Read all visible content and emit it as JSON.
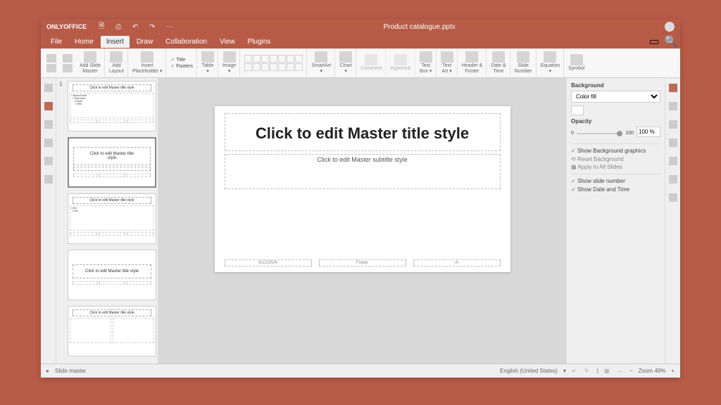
{
  "app": {
    "brand": "ONLYOFFICE",
    "filename": "Product catalogue.pptx"
  },
  "menu": {
    "items": [
      "File",
      "Home",
      "Insert",
      "Draw",
      "Collaboration",
      "View",
      "Plugins"
    ],
    "active_index": 2
  },
  "ribbon": {
    "add_slide_master": "Add Slide\nMaster",
    "add_layout": "Add\nLayout",
    "insert_placeholder": "Insert\nPlaceholder ▾",
    "chk_title": "Title",
    "chk_footers": "Footers",
    "table": "Table\n▾",
    "image": "Image\n▾",
    "smartart": "SmartArt\n▾",
    "chart": "Chart\n▾",
    "comment": "Comment",
    "hyperlink": "Hyperlink",
    "textbox": "Text\nBox ▾",
    "textart": "Text\nArt ▾",
    "header_footer": "Header &\nFooter",
    "date_time": "Date &\nTime",
    "slide_number": "Slide\nNumber",
    "equation": "Equation\n▾",
    "symbol": "Symbol"
  },
  "thumbs": {
    "number": "1",
    "master_title": "Click to edit Master title style",
    "layout_title": "Click to edit Master title\nstyle"
  },
  "slide": {
    "title": "Click to edit Master title style",
    "subtitle": "Click to edit Master subtitle style",
    "footer_date": "6/13/2024",
    "footer_text": "Footer",
    "footer_num": "‹#›"
  },
  "rightpanel": {
    "background": "Background",
    "fill_type": "Color fill",
    "opacity_label": "Opacity",
    "opacity_min": "0",
    "opacity_max": "100",
    "opacity_val": "100 %",
    "show_bg_graphics": "Show Background graphics",
    "reset_bg": "Reset Background",
    "apply_all": "Apply to All Slides",
    "show_slide_num": "Show slide number",
    "show_date_time": "Show Date and Time"
  },
  "statusbar": {
    "mode": "Slide master",
    "language": "English (United States)",
    "zoom": "Zoom 49%"
  }
}
